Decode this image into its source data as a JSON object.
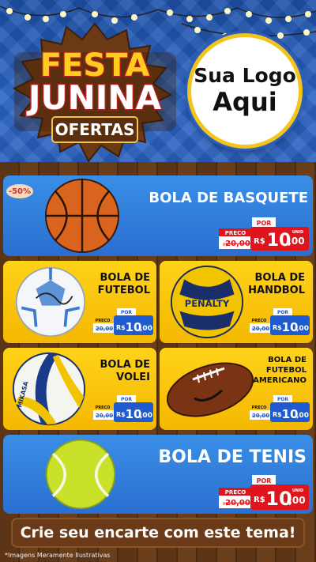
{
  "header": {
    "badge_line1": "FESTA",
    "badge_line2": "JUNINA",
    "badge_line3": "OFERTAS",
    "logo_line1": "Sua Logo",
    "logo_line2": "Aqui"
  },
  "colors": {
    "header_blue": "#2a66c6",
    "card_blue": "#3a8ee6",
    "card_yellow": "#ffd21a",
    "price_red": "#e0141c",
    "price_blue": "#1f5bd0",
    "wood": "#5c3516"
  },
  "products": [
    {
      "name": "BOLA DE BASQUETE",
      "badge": "-50%",
      "label_preco": "PRECO",
      "old_price": "20,00",
      "label_por": "POR",
      "currency": "R$",
      "price_int": "10",
      "price_dec": ",00",
      "unit": "UNID",
      "old_currency": "R$"
    },
    {
      "name_l1": "BOLA DE",
      "name_l2": "FUTEBOL",
      "label_preco": "PRECO",
      "old_price": "20,00",
      "label_por": "POR",
      "currency": "R$",
      "price_int": "10",
      "price_dec": ",00",
      "unit": "UNID"
    },
    {
      "name_l1": "BOLA DE",
      "name_l2": "HANDBOL",
      "label_preco": "PRECO",
      "old_price": "20,00",
      "label_por": "POR",
      "currency": "R$",
      "price_int": "10",
      "price_dec": ",00",
      "unit": "UNID"
    },
    {
      "name_l1": "BOLA DE",
      "name_l2": "VOLEI",
      "label_preco": "PRECO",
      "old_price": "20,00",
      "label_por": "POR",
      "currency": "R$",
      "price_int": "10",
      "price_dec": ",00",
      "unit": "UNID"
    },
    {
      "name_l1": "BOLA DE",
      "name_l2": "FUTEBOL",
      "name_l3": "AMERICANO",
      "label_preco": "PRECO",
      "old_price": "20,00",
      "label_por": "POR",
      "currency": "R$",
      "price_int": "10",
      "price_dec": ",00",
      "unit": "UNID"
    },
    {
      "name": "BOLA DE TENIS",
      "label_preco": "PRECO",
      "old_price": "20,00",
      "label_por": "POR",
      "currency": "R$",
      "price_int": "10",
      "price_dec": ",00",
      "unit": "UNID",
      "old_currency": "R$"
    }
  ],
  "ball_brands": {
    "handbol": "PENALTY",
    "volei": "MIKASA"
  },
  "footer": {
    "cta": "Crie seu encarte com este tema!",
    "disclaimer": "*Imagens Meramente Ilustrativas"
  }
}
